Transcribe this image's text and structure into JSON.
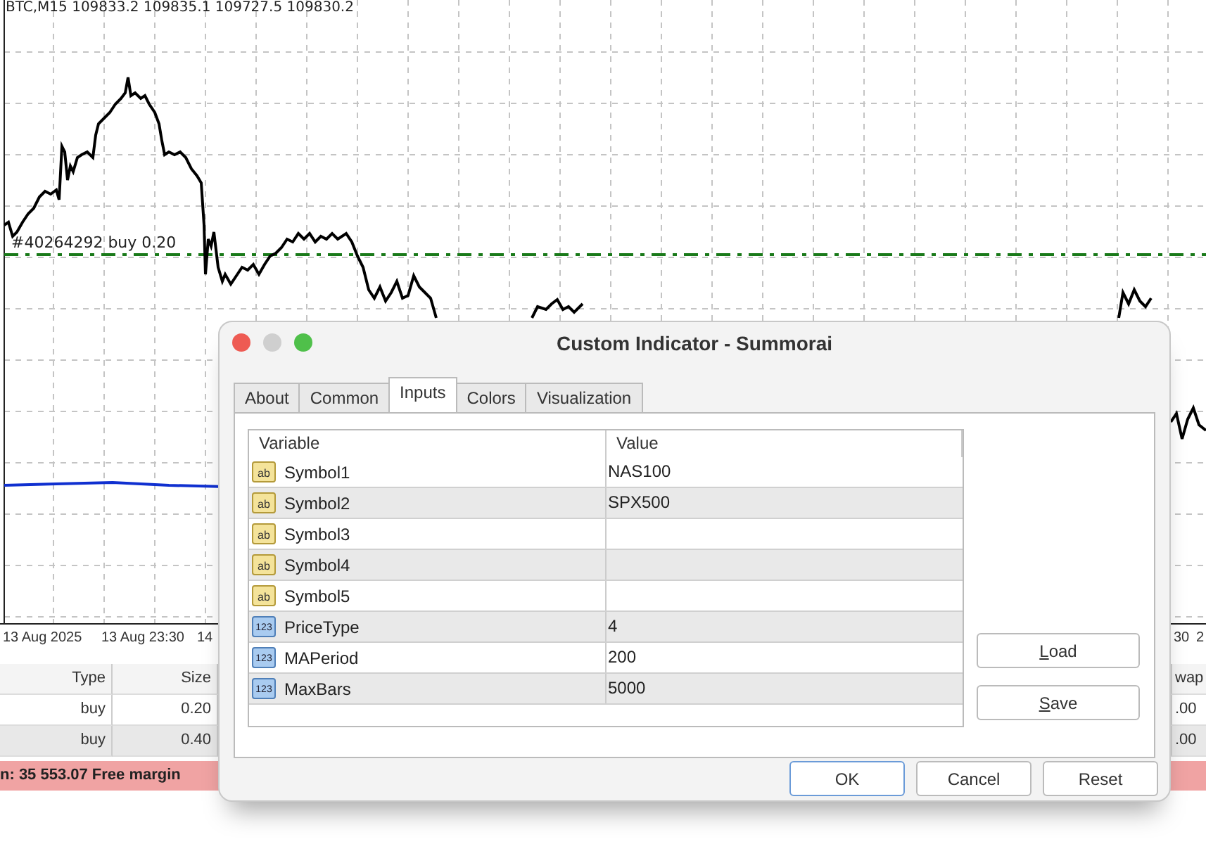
{
  "chart": {
    "header": "BTC,M15  109833.2 109835.1 109727.5 109830.2",
    "order_label": "#40264292 buy 0.20",
    "time_labels": [
      "13 Aug 2025",
      "13 Aug 23:30",
      "14",
      "30",
      "2"
    ]
  },
  "trades": {
    "columns": [
      "Type",
      "Size",
      "wap"
    ],
    "rows": [
      {
        "cells": [
          "buy",
          "0.20",
          ".00"
        ]
      },
      {
        "cells": [
          "buy",
          "0.40",
          ".00"
        ]
      }
    ]
  },
  "status_bar": "n: 35 553.07  Free margin",
  "dialog": {
    "title": "Custom Indicator - Summorai",
    "tabs": [
      {
        "label": "About",
        "selected": false
      },
      {
        "label": "Common",
        "selected": false
      },
      {
        "label": "Inputs",
        "selected": true
      },
      {
        "label": "Colors",
        "selected": false
      },
      {
        "label": "Visualization",
        "selected": false
      }
    ],
    "columns": [
      "Variable",
      "Value"
    ],
    "inputs": [
      {
        "kind": "string",
        "badge": "ab",
        "variable": "Symbol1",
        "value": "NAS100"
      },
      {
        "kind": "string",
        "badge": "ab",
        "variable": "Symbol2",
        "value": "SPX500"
      },
      {
        "kind": "string",
        "badge": "ab",
        "variable": "Symbol3"
      },
      {
        "kind": "string",
        "badge": "ab",
        "variable": "Symbol4"
      },
      {
        "kind": "string",
        "badge": "ab",
        "variable": "Symbol5"
      },
      {
        "kind": "number",
        "badge": "123",
        "variable": "PriceType",
        "value": "4"
      },
      {
        "kind": "number",
        "badge": "123",
        "variable": "MAPeriod",
        "value": "200"
      },
      {
        "kind": "number",
        "badge": "123",
        "variable": "MaxBars",
        "value": "5000"
      }
    ],
    "side_buttons": [
      "Load",
      "Save"
    ],
    "buttons": [
      {
        "label": "OK",
        "kind": "default"
      },
      {
        "label": "Cancel",
        "kind": "normal"
      },
      {
        "label": "Reset",
        "kind": "normal"
      }
    ]
  }
}
